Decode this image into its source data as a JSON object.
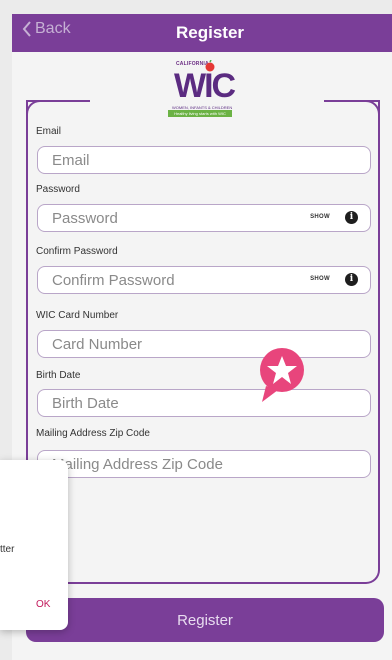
{
  "header": {
    "back_label": "Back",
    "title": "Register"
  },
  "logo": {
    "state": "CALIFORNIA",
    "brand": "WIC",
    "tagline": "WOMEN, INFANTS & CHILDREN",
    "slogan": "Healthy living starts with WIC"
  },
  "form": {
    "email": {
      "label": "Email",
      "placeholder": "Email"
    },
    "password": {
      "label": "Password",
      "placeholder": "Password",
      "show_label": "SHOW"
    },
    "confirm_password": {
      "label": "Confirm Password",
      "placeholder": "Confirm Password",
      "show_label": "SHOW"
    },
    "card_number": {
      "label": "WIC Card Number",
      "placeholder": "Card Number"
    },
    "birth_date": {
      "label": "Birth Date",
      "placeholder": "Birth Date"
    },
    "zip": {
      "label": "Mailing Address Zip Code",
      "placeholder": "Mailing Address Zip Code"
    }
  },
  "register_button": "Register",
  "dialog": {
    "message_fragment": "tter",
    "ok_label": "OK"
  },
  "colors": {
    "brand_purple": "#7a3e98",
    "accent_pink": "#e8457c"
  }
}
